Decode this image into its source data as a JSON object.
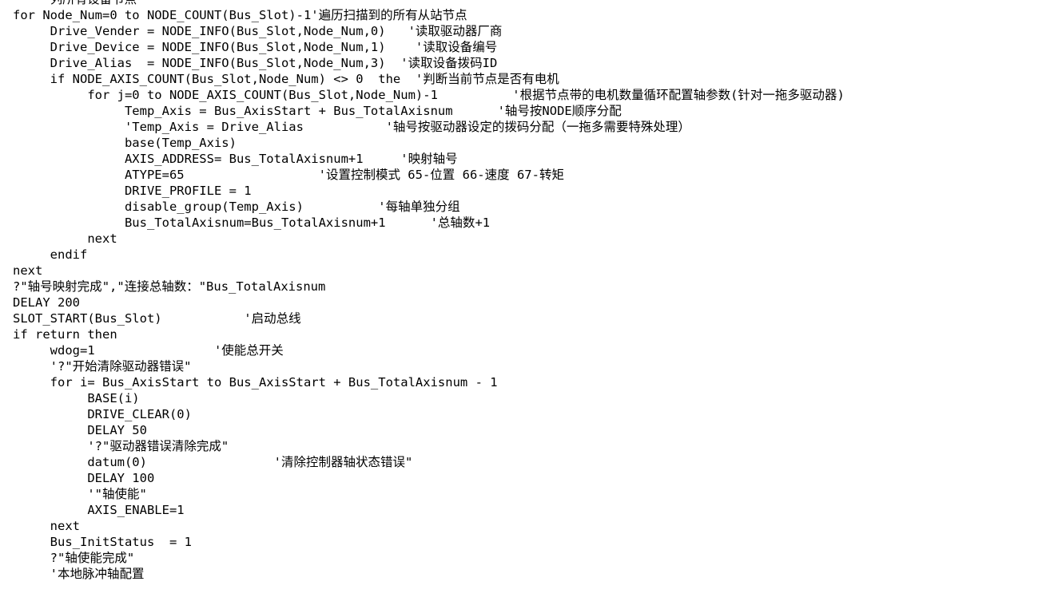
{
  "document": {
    "kind": "source-code-listing",
    "language": "Trio BASIC motion controller program",
    "background_color": "#ffffff",
    "text_color": "#000000",
    "first_line_clipped": true,
    "lines": [
      "    '列所有设备节点",
      "for Node_Num=0 to NODE_COUNT(Bus_Slot)-1'遍历扫描到的所有从站节点",
      "     Drive_Vender = NODE_INFO(Bus_Slot,Node_Num,0)   '读取驱动器厂商",
      "     Drive_Device = NODE_INFO(Bus_Slot,Node_Num,1)    '读取设备编号",
      "     Drive_Alias  = NODE_INFO(Bus_Slot,Node_Num,3)  '读取设备拨码ID",
      "     if NODE_AXIS_COUNT(Bus_Slot,Node_Num) <> 0  the  '判断当前节点是否有电机",
      "          for j=0 to NODE_AXIS_COUNT(Bus_Slot,Node_Num)-1          '根据节点带的电机数量循环配置轴参数(针对一拖多驱动器)",
      "               Temp_Axis = Bus_AxisStart + Bus_TotalAxisnum      '轴号按NODE顺序分配",
      "               'Temp_Axis = Drive_Alias           '轴号按驱动器设定的拨码分配（一拖多需要特殊处理）",
      "               base(Temp_Axis)",
      "               AXIS_ADDRESS= Bus_TotalAxisnum+1     '映射轴号",
      "               ATYPE=65                  '设置控制模式 65-位置 66-速度 67-转矩",
      "               DRIVE_PROFILE = 1",
      "               disable_group(Temp_Axis)          '每轴单独分组",
      "               Bus_TotalAxisnum=Bus_TotalAxisnum+1      '总轴数+1",
      "          next",
      "     endif",
      "next",
      "?\"轴号映射完成\",\"连接总轴数：\"Bus_TotalAxisnum",
      "DELAY 200",
      "SLOT_START(Bus_Slot)           '启动总线",
      "if return then",
      "     wdog=1                '使能总开关",
      "     '?\"开始清除驱动器错误\"",
      "     for i= Bus_AxisStart to Bus_AxisStart + Bus_TotalAxisnum - 1",
      "          BASE(i)",
      "          DRIVE_CLEAR(0)",
      "          DELAY 50",
      "          '?\"驱动器错误清除完成\"",
      "          datum(0)                 '清除控制器轴状态错误\"",
      "          DELAY 100",
      "          '\"轴使能\"",
      "          AXIS_ENABLE=1",
      "     next",
      "     Bus_InitStatus  = 1",
      "     ?\"轴使能完成\"",
      "     '本地脉冲轴配置"
    ]
  }
}
